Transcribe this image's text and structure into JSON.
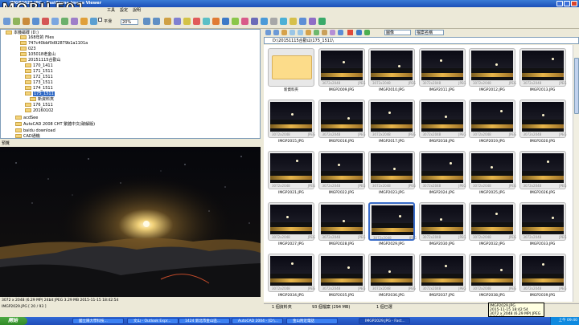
{
  "window": {
    "title": "IMGP2029.JPG - FastStone Image Viewer"
  },
  "menu": {
    "tools": "工具",
    "settings": "設定",
    "help": "說明"
  },
  "toolbar": {
    "smooth_label": "平滑",
    "zoom": "20%",
    "view_mode": "圖像",
    "sort": "檔案名稱"
  },
  "tree": {
    "rows": [
      "本機磁碟 (D:)",
      "168年的 Files",
      "747c40bbf0d92879b1a1101a",
      "023",
      "105018老金山",
      "20151115合歡山",
      "170_1411",
      "171_1511",
      "172_1511",
      "173_1511",
      "174_1511",
      "175_1511",
      "新資料夾",
      "176_1511",
      "20160102",
      "acdSee",
      "AutoCAD 2008 CHT 繁體中文(破解版)",
      "baidu download",
      "CAD通機"
    ]
  },
  "preview": {
    "header": "預覽",
    "info": "3072 x 2048 (6.29 MP)  24bit  JPEG   3.29 MB   2015-11-15 18:42:54",
    "status": "IMGP2029.JPG [ 20 / 93 ]"
  },
  "address": {
    "path": "D:\\20151115合歡山\\175_1511\\"
  },
  "thumbs": {
    "meta_size": "3072x2048",
    "meta_type": "JPEG",
    "items": [
      "新資料夾",
      "IMGP2009.JPG",
      "IMGP2010.JPG",
      "IMGP2011.JPG",
      "IMGP2012.JPG",
      "IMGP2013.JPG",
      "IMGP2015.JPG",
      "IMGP2016.JPG",
      "IMGP2017.JPG",
      "IMGP2018.JPG",
      "IMGP2019.JPG",
      "IMGP2020.JPG",
      "IMGP2021.JPG",
      "IMGP2022.JPG",
      "IMGP2023.JPG",
      "IMGP2024.JPG",
      "IMGP2025.JPG",
      "IMGP2026.JPG",
      "IMGP2027.JPG",
      "IMGP2028.JPG",
      "IMGP2029.JPG",
      "IMGP2030.JPG",
      "IMGP2032.JPG",
      "IMGP2033.JPG",
      "IMGP2034.JPG",
      "IMGP2035.JPG",
      "IMGP2036.JPG",
      "IMGP2037.JPG",
      "IMGP2038.JPG",
      "IMGP2039.JPG"
    ]
  },
  "status": {
    "folders": "1 個資料夾",
    "files": "93 個檔案 (294 MB)",
    "selected": "1 個已選"
  },
  "tooltip": {
    "line1": "IMGP2029.JPG",
    "line2": "2015-11-15 18:42:54",
    "line3": "3072 x 2048 (6.29 MP) JPEG",
    "line4": "3.29 MB"
  },
  "taskbar": {
    "start": "開始",
    "tasks": [
      "國立陽大學科技...",
      "文山 - Outlook Expr...",
      "1424 新北市金山區...",
      "AutoCAD 2004 - [D:\\...",
      "金山附近電話",
      "IMGP2029.JPG - Fast..."
    ],
    "clock": "上午 09:40"
  },
  "colors": {
    "title_blue": "#1b4fb8",
    "selection": "#316ac5",
    "folder": "#fcdc8a"
  }
}
